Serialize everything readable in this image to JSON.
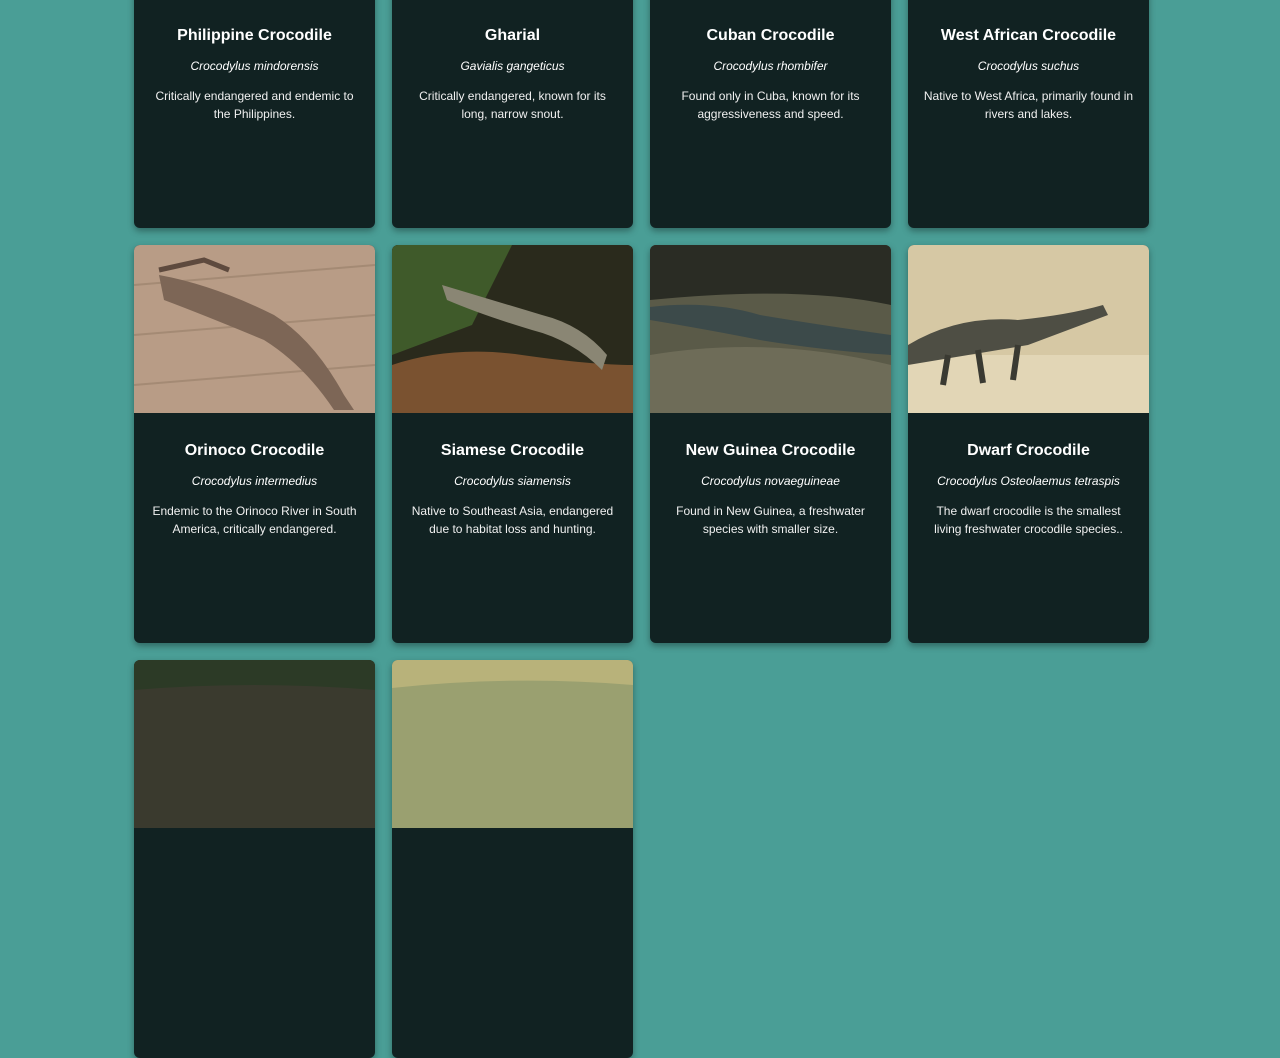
{
  "cards": [
    {
      "name": "Philippine Crocodile",
      "scientific_name": "Crocodylus mindorensis",
      "description": "Critically endangered and endemic to the Philippines."
    },
    {
      "name": "Gharial",
      "scientific_name": "Gavialis gangeticus",
      "description": "Critically endangered, known for its long, narrow snout."
    },
    {
      "name": "Cuban Crocodile",
      "scientific_name": "Crocodylus rhombifer",
      "description": "Found only in Cuba, known for its aggressiveness and speed."
    },
    {
      "name": "West African Crocodile",
      "scientific_name": "Crocodylus suchus",
      "description": "Native to West Africa, primarily found in rivers and lakes."
    },
    {
      "name": "Orinoco Crocodile",
      "scientific_name": "Crocodylus intermedius",
      "description": "Endemic to the Orinoco River in South America, critically endangered."
    },
    {
      "name": "Siamese Crocodile",
      "scientific_name": "Crocodylus siamensis",
      "description": "Native to Southeast Asia, endangered due to habitat loss and hunting."
    },
    {
      "name": "New Guinea Crocodile",
      "scientific_name": "Crocodylus novaeguineae",
      "description": "Found in New Guinea, a freshwater species with smaller size."
    },
    {
      "name": "Dwarf Crocodile",
      "scientific_name": "Crocodylus Osteolaemus tetraspis",
      "description": "The dwarf crocodile is the smallest living freshwater crocodile species.."
    },
    {},
    {}
  ],
  "colors": {
    "page_background": "#4a9e96",
    "card_background": "#112222",
    "text": "#ffffff"
  }
}
